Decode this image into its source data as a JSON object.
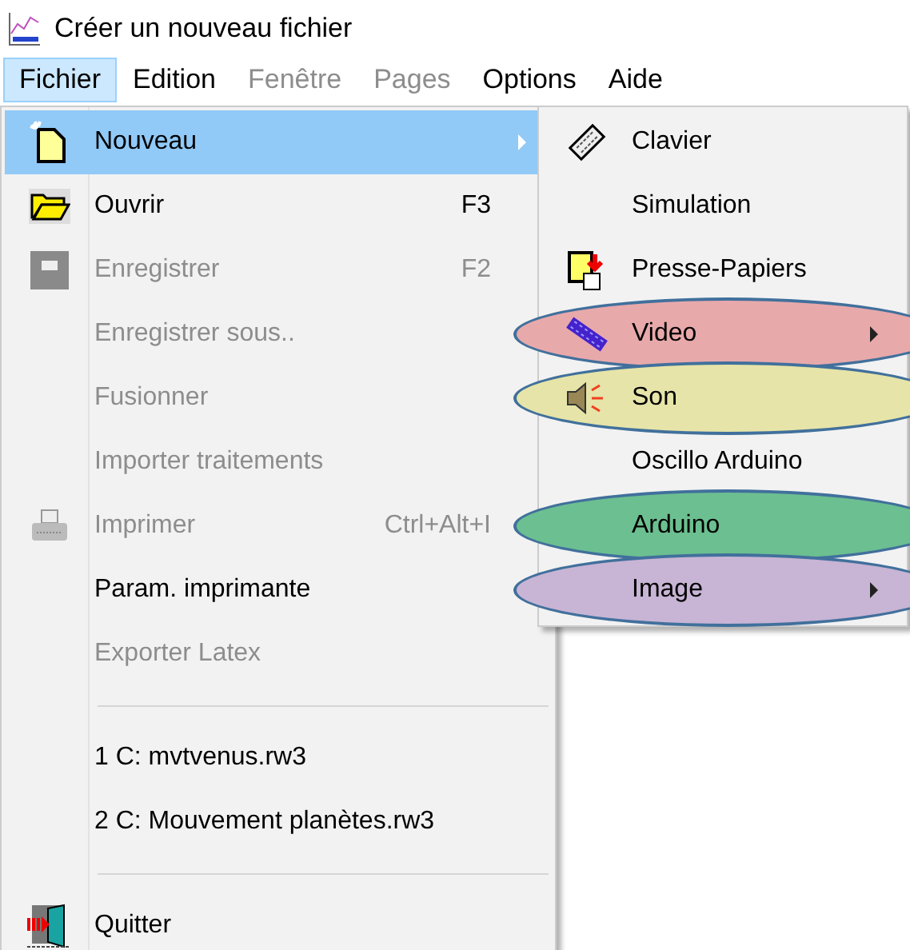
{
  "window": {
    "title": "Créer un nouveau fichier"
  },
  "menubar": [
    {
      "label": "Fichier",
      "selected": true,
      "disabled": false
    },
    {
      "label": "Edition",
      "selected": false,
      "disabled": false
    },
    {
      "label": "Fenêtre",
      "selected": false,
      "disabled": true
    },
    {
      "label": "Pages",
      "selected": false,
      "disabled": true
    },
    {
      "label": "Options",
      "selected": false,
      "disabled": false
    },
    {
      "label": "Aide",
      "selected": false,
      "disabled": false
    }
  ],
  "menu": [
    {
      "kind": "item",
      "label": "Nouveau",
      "selected": true,
      "disabled": false,
      "submenu": true
    },
    {
      "kind": "item",
      "label": "Ouvrir",
      "shortcut": "F3",
      "selected": false,
      "disabled": false,
      "submenu": false
    },
    {
      "kind": "item",
      "label": "Enregistrer",
      "shortcut": "F2",
      "selected": false,
      "disabled": true,
      "submenu": false
    },
    {
      "kind": "item",
      "label": "Enregistrer sous..",
      "selected": false,
      "disabled": true,
      "submenu": false
    },
    {
      "kind": "item",
      "label": "Fusionner",
      "selected": false,
      "disabled": true,
      "submenu": false
    },
    {
      "kind": "item",
      "label": "Importer traitements",
      "selected": false,
      "disabled": true,
      "submenu": false
    },
    {
      "kind": "item",
      "label": "Imprimer",
      "shortcut": "Ctrl+Alt+I",
      "selected": false,
      "disabled": true,
      "submenu": false
    },
    {
      "kind": "item",
      "label": "Param. imprimante",
      "selected": false,
      "disabled": false,
      "submenu": false
    },
    {
      "kind": "item",
      "label": "Exporter Latex",
      "selected": false,
      "disabled": true,
      "submenu": false
    },
    {
      "kind": "separator"
    },
    {
      "kind": "item",
      "label": "1 C: mvtvenus.rw3",
      "selected": false,
      "disabled": false,
      "submenu": false
    },
    {
      "kind": "item",
      "label": "2 C: Mouvement planètes.rw3",
      "selected": false,
      "disabled": false,
      "submenu": false
    },
    {
      "kind": "separator"
    },
    {
      "kind": "item",
      "label": "Quitter",
      "selected": false,
      "disabled": false,
      "submenu": false
    }
  ],
  "submenu": [
    {
      "label": "Clavier",
      "submenu": false
    },
    {
      "label": "Simulation",
      "submenu": false
    },
    {
      "label": "Presse-Papiers",
      "submenu": false
    },
    {
      "label": "Video",
      "submenu": true,
      "color": "#e8a9ab"
    },
    {
      "label": "Son",
      "submenu": false,
      "color": "#e6e4a8"
    },
    {
      "label": "Oscillo Arduino",
      "submenu": false
    },
    {
      "label": "Arduino",
      "submenu": false,
      "color": "#6cbf90"
    },
    {
      "label": "Image",
      "submenu": true,
      "color": "#c8b4d4"
    }
  ]
}
